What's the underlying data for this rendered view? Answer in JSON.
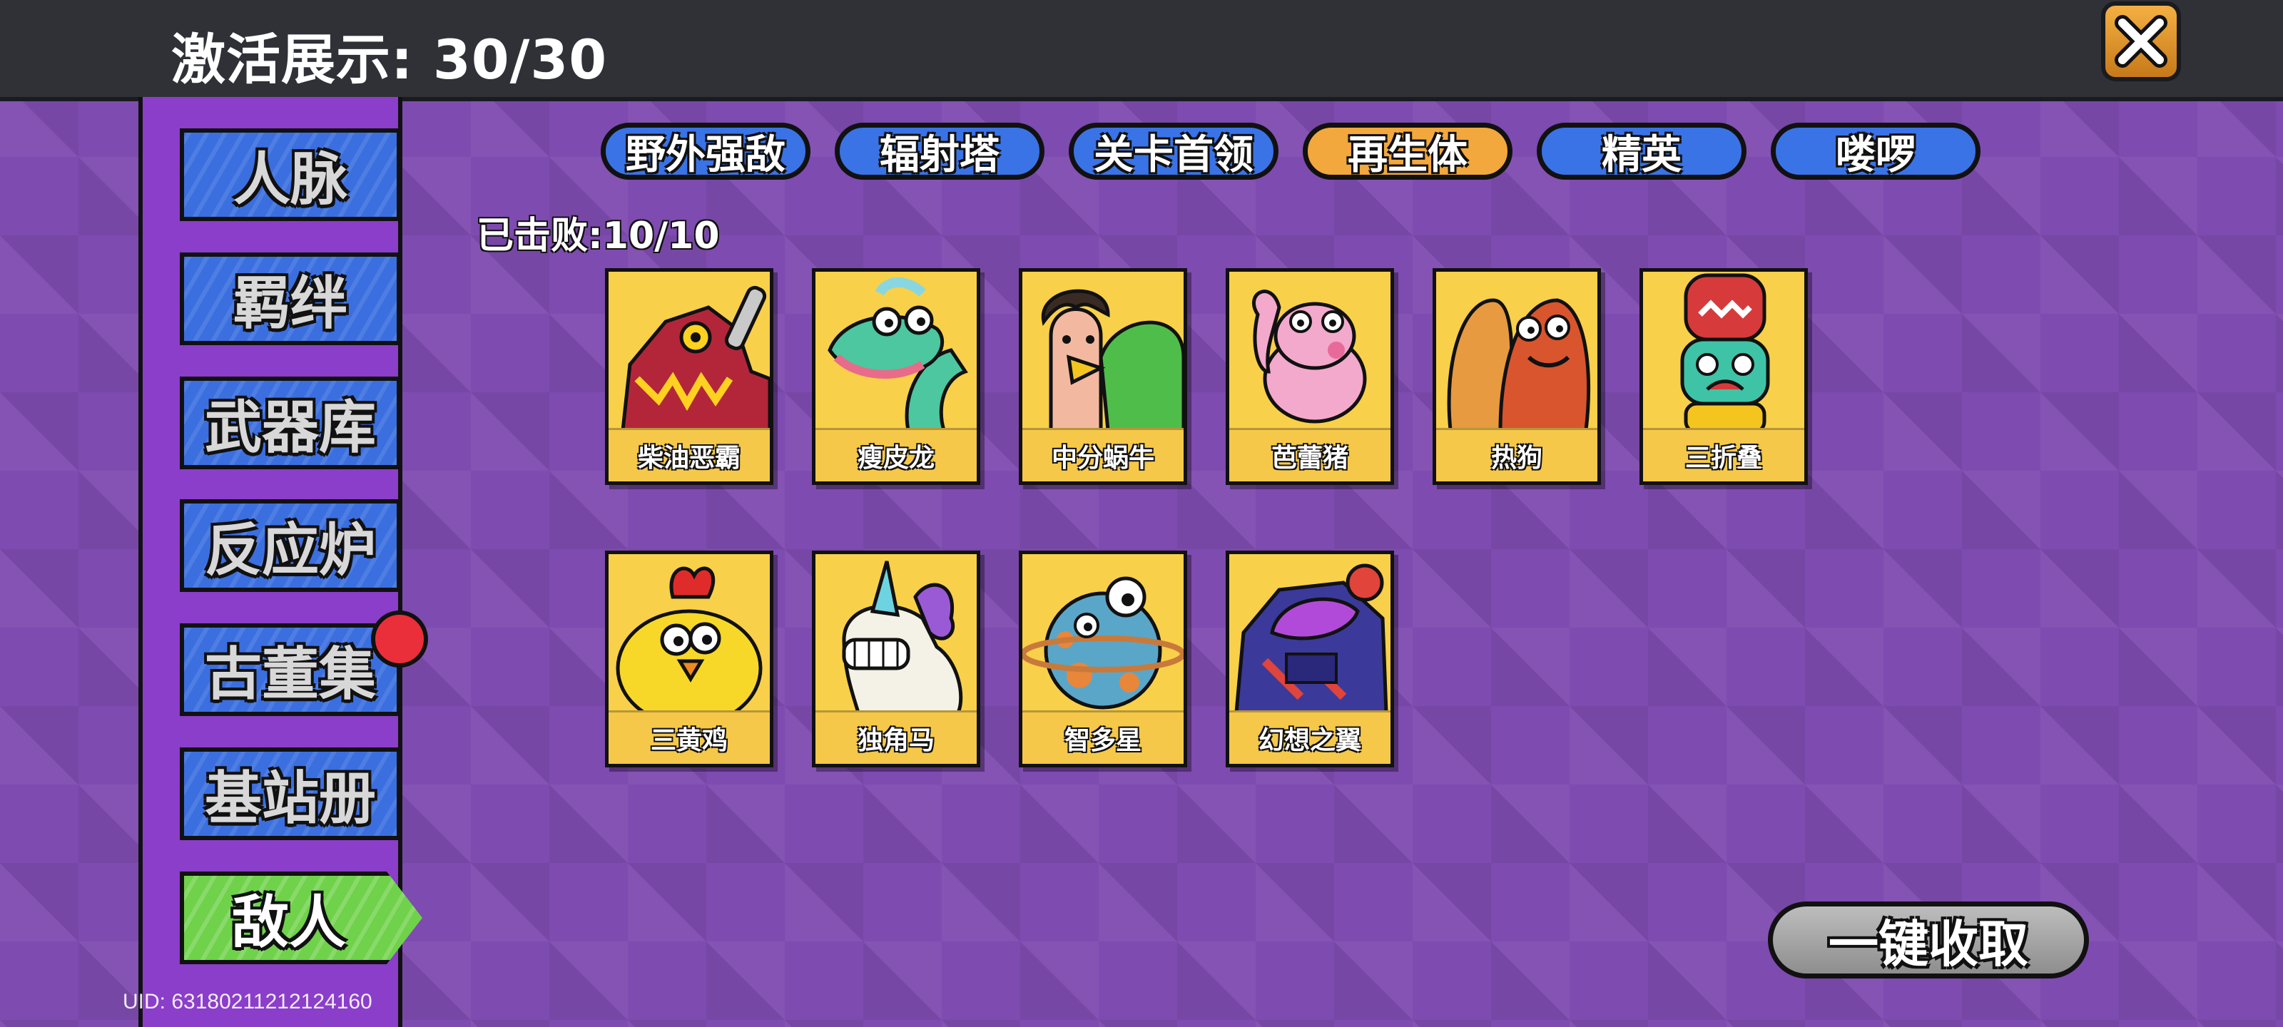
{
  "header": {
    "title": "激活展示: 30/30",
    "close_icon": "close-x-icon"
  },
  "sidebar": {
    "items": [
      {
        "label": "人脉"
      },
      {
        "label": "羁绊"
      },
      {
        "label": "武器库"
      },
      {
        "label": "反应炉"
      },
      {
        "label": "古董集"
      },
      {
        "label": "基站册"
      },
      {
        "label": "敌人"
      }
    ],
    "active_index": 6
  },
  "tabs": [
    {
      "label": "野外强敌"
    },
    {
      "label": "辐射塔"
    },
    {
      "label": "关卡首领"
    },
    {
      "label": "再生体"
    },
    {
      "label": "精英"
    },
    {
      "label": "喽啰"
    }
  ],
  "active_tab_index": 3,
  "defeated_text": "已击败:10/10",
  "enemies": [
    {
      "name": "柴油恶霸",
      "icon": "red-robot-dino-icon"
    },
    {
      "name": "瘦皮龙",
      "icon": "green-dragon-icon"
    },
    {
      "name": "中分蜗牛",
      "icon": "snail-man-icon"
    },
    {
      "name": "芭蕾猪",
      "icon": "pink-pig-icon"
    },
    {
      "name": "热狗",
      "icon": "hotdog-icon"
    },
    {
      "name": "三折叠",
      "icon": "totem-stack-icon"
    },
    {
      "name": "三黄鸡",
      "icon": "yellow-chicken-icon"
    },
    {
      "name": "独角马",
      "icon": "unicorn-icon"
    },
    {
      "name": "智多星",
      "icon": "planet-icon"
    },
    {
      "name": "幻想之翼",
      "icon": "purple-mech-icon"
    }
  ],
  "collect_button": "一键收取",
  "uid": "UID: 63180211212124160",
  "colors": {
    "background": "#7e4bb0",
    "topbar": "#2f3137",
    "tab_blue": "#3a73e6",
    "tab_active": "#f2a83c",
    "side_item": "#3b6fe0",
    "side_active": "#6fd24a",
    "card": "#f6cb3c",
    "badge": "#ea2f3a"
  }
}
